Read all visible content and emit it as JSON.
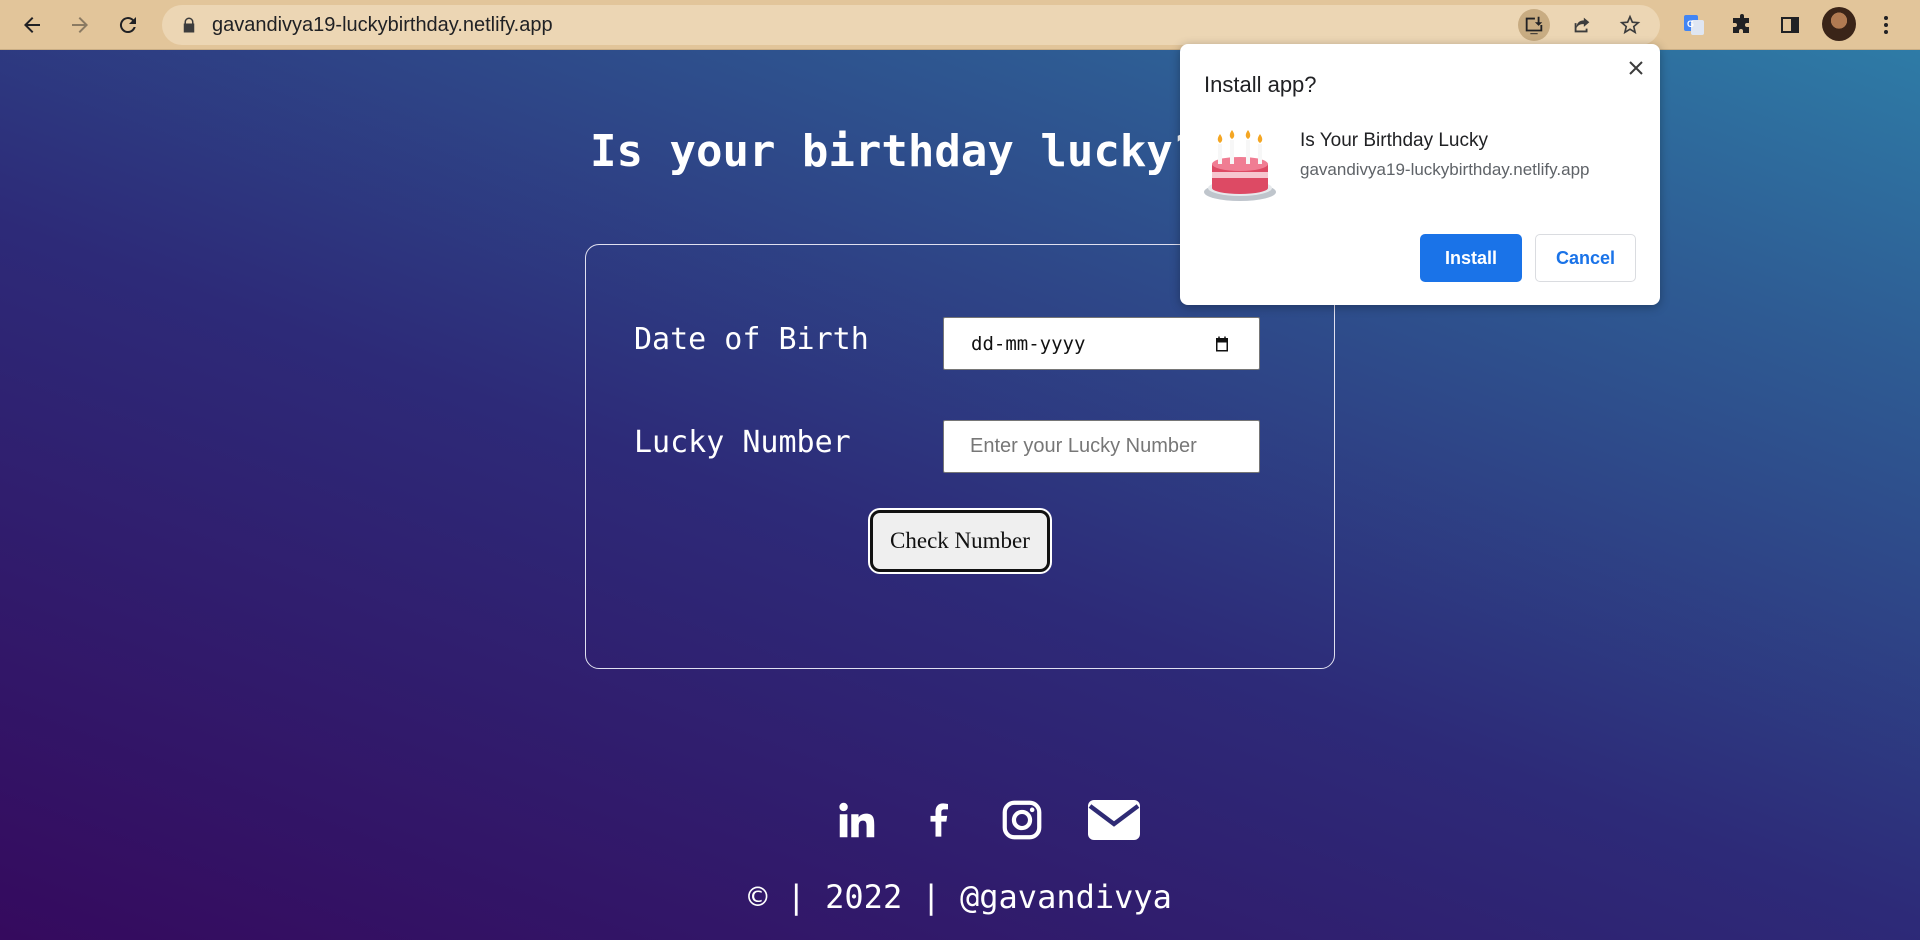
{
  "browser": {
    "url": "gavandivya19-luckybirthday.netlify.app",
    "icons": [
      "back-arrow-icon",
      "forward-arrow-icon",
      "reload-icon",
      "lock-icon",
      "install-app-icon",
      "share-icon",
      "bookmark-star-icon",
      "google-translate-icon",
      "extensions-puzzle-icon",
      "side-panel-icon",
      "profile-avatar",
      "kebab-menu-icon"
    ]
  },
  "page": {
    "heading": "Is your birthday lucky?",
    "form": {
      "dob_label": "Date of Birth",
      "dob_value": "dd-mm-yyyy",
      "lucky_label": "Lucky Number",
      "lucky_placeholder": "Enter your Lucky Number",
      "lucky_value": "",
      "check_button": "Check Number"
    },
    "social_icons": [
      "linkedin-icon",
      "facebook-icon",
      "instagram-icon",
      "email-icon"
    ],
    "footer": "© | 2022 | @gavandivya"
  },
  "install_popup": {
    "title": "Install app?",
    "app_name": "Is Your Birthday Lucky",
    "app_url": "gavandivya19-luckybirthday.netlify.app",
    "install_label": "Install",
    "cancel_label": "Cancel",
    "app_icon": "birthday-cake-icon"
  },
  "colors": {
    "toolbar": "#e2c59a",
    "accent_blue": "#1a73e8",
    "gradient_start": "#350a5e",
    "gradient_end": "#2e7ba6"
  }
}
